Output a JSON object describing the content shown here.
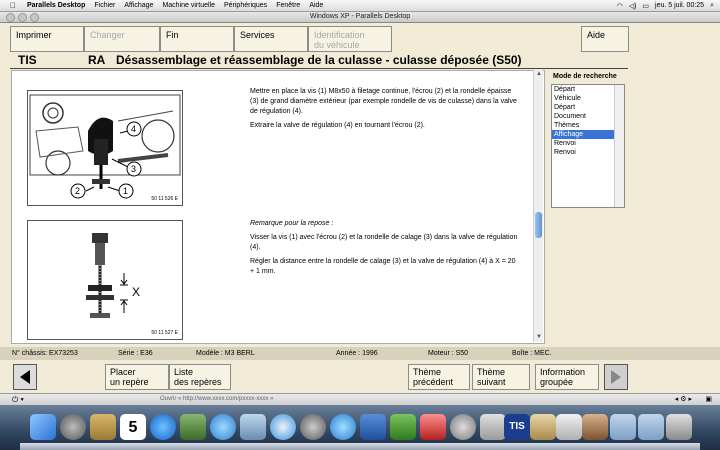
{
  "menubar": {
    "app": "Parallels Desktop",
    "items": [
      "Fichier",
      "Affichage",
      "Machine virtuelle",
      "Périphériques",
      "Fenêtre",
      "Aide"
    ],
    "clock": "jeu. 5 juil.  00:25"
  },
  "window": {
    "title": "Windows XP - Parallels Desktop"
  },
  "toolbar": {
    "imprimer": "Imprimer",
    "changer": "Changer",
    "fin": "Fin",
    "services": "Services",
    "identification_l1": "Identification",
    "identification_l2": "du véhicule",
    "aide": "Aide"
  },
  "header": {
    "tis": "TIS",
    "ra": "RA",
    "title": "Désassemblage et réassemblage de la culasse - culasse déposée (S50)"
  },
  "content": {
    "fig1": {
      "code": "50 11 526 E",
      "labels": [
        "1",
        "2",
        "3",
        "4"
      ]
    },
    "fig2": {
      "code": "50 11 527 E",
      "label_x": "X"
    },
    "para1": "Mettre en place la vis (1) M8x50 à filetage continue, l'écrou (2) et la rondelle épaisse (3) de grand diamètre extérieur (par exemple rondelle de vis de culasse) dans la valve de régulation (4).",
    "para2": "Extraire la valve de régulation (4) en tournant l'écrou (2).",
    "remark": "Remarque pour la repose :",
    "para3": "Visser la vis (1) avec l'écrou (2) et la rondelle de calage (3) dans la valve de régulation (4).",
    "para4": "Régler la distance entre la rondelle de calage (3) et la valve de régulation (4) à X = 20 + 1 mm."
  },
  "search": {
    "label": "Mode de recherche",
    "items": [
      "Départ",
      "Véhicule",
      "Départ",
      "Document",
      "Thèmes",
      "Affichage",
      "Renvoi",
      "Renvoi"
    ],
    "selected": "Affichage"
  },
  "status": {
    "chassis": "N° châssis: EX73253",
    "serie": "Série : E36",
    "modele": "Modèle : M3 BERL",
    "annee": "Année : 1996",
    "moteur": "Moteur : S50",
    "boite": "Boîte : MEC."
  },
  "bottom": {
    "placer_l1": "Placer",
    "placer_l2": "un repère",
    "liste_l1": "Liste",
    "liste_l2": "des repères",
    "prec_l1": "Thème",
    "prec_l2": "précédent",
    "suiv_l1": "Thème",
    "suiv_l2": "suivant",
    "info_l1": "Information",
    "info_l2": "groupée"
  },
  "pbar": {
    "url": "Ouvrir « http://www.xxxx.com/pxxxx-xxxx »"
  },
  "dock": {
    "calendar_day": "5",
    "tis_label": "TIS",
    "icons": [
      "finder-icon",
      "rocket-icon",
      "contacts-icon",
      "calendar-icon",
      "appstore-icon",
      "photo-icon",
      "itunes-icon",
      "preview-icon",
      "safari-icon",
      "spotlight-icon",
      "messages-icon",
      "word-icon",
      "excel-icon",
      "photobooth-icon",
      "settings-icon",
      "parallels-icon",
      "tis-icon",
      "chess-icon",
      "home-icon",
      "photos-icon",
      "folder-icon",
      "folder-icon",
      "trash-icon"
    ]
  },
  "colors": {
    "accent_selection": "#3874d8",
    "window_bg": "#f0ead6"
  }
}
